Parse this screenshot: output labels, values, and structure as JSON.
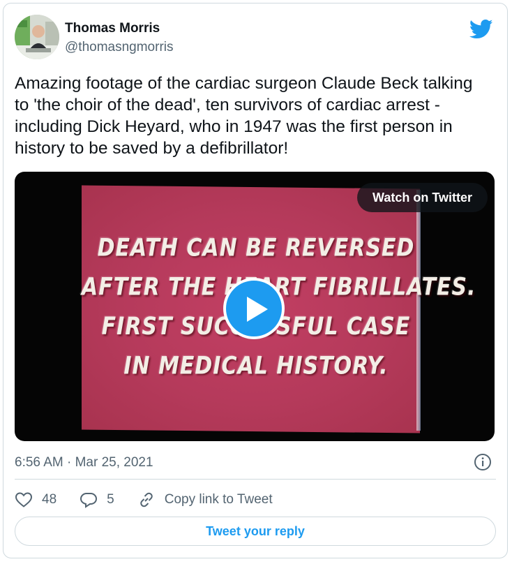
{
  "author": {
    "name": "Thomas Morris",
    "handle": "@thomasngmorris"
  },
  "tweet": {
    "text": "Amazing footage of the cardiac surgeon Claude Beck talking to 'the choir of the dead', ten survivors of cardiac arrest - including Dick Heyard, who in 1947 was the first person in history to be saved by a defibrillator!",
    "timestamp": "6:56 AM · Mar 25, 2021"
  },
  "media": {
    "watch_label": "Watch on Twitter",
    "frame_caption": [
      "DEATH CAN BE REVERSED",
      "AFTER THE HEART FIBRILLATES.",
      "FIRST SUCCESSFUL CASE",
      "IN MEDICAL HISTORY."
    ]
  },
  "actions": {
    "likes": "48",
    "replies": "5",
    "copy_link_label": "Copy link to Tweet"
  },
  "reply_button_label": "Tweet your reply",
  "colors": {
    "accent": "#1d9bf0",
    "secondary_text": "#536471",
    "border": "#cfd9de"
  },
  "icons": [
    "twitter-bird-icon",
    "play-icon",
    "info-icon",
    "heart-icon",
    "reply-icon",
    "link-icon"
  ]
}
